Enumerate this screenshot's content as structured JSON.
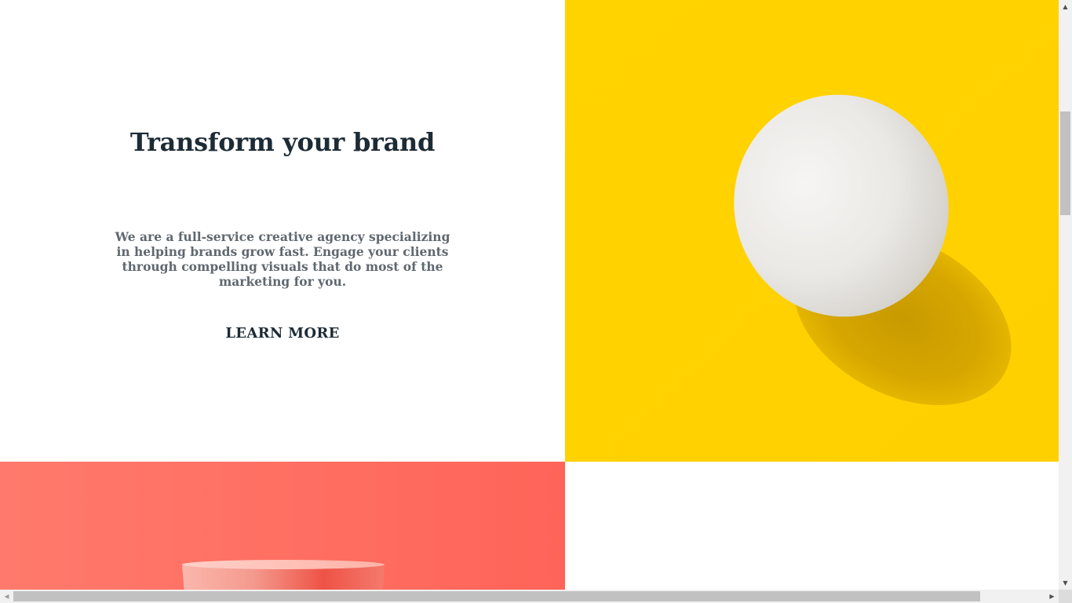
{
  "hero": {
    "title": "Transform your brand",
    "description": "We are a full-service creative agency specializing in helping brands grow fast. Engage your clients through compelling visuals that do most of the marketing for you.",
    "cta_label": "LEARN MORE"
  },
  "images": {
    "egg": {
      "subject": "white egg on yellow background",
      "background_color": "#FFD200"
    },
    "cup": {
      "subject": "pink cup on coral background",
      "background_color": "#FF6E5E"
    }
  },
  "colors": {
    "heading": "#1D2B36",
    "body_text": "#5F6870",
    "page_background": "#FFFFFF"
  },
  "scrollbars": {
    "vertical": {
      "up_icon": "triangle-up-icon",
      "down_icon": "triangle-down-icon"
    },
    "horizontal": {
      "left_icon": "triangle-left-icon",
      "right_icon": "triangle-right-icon"
    }
  }
}
